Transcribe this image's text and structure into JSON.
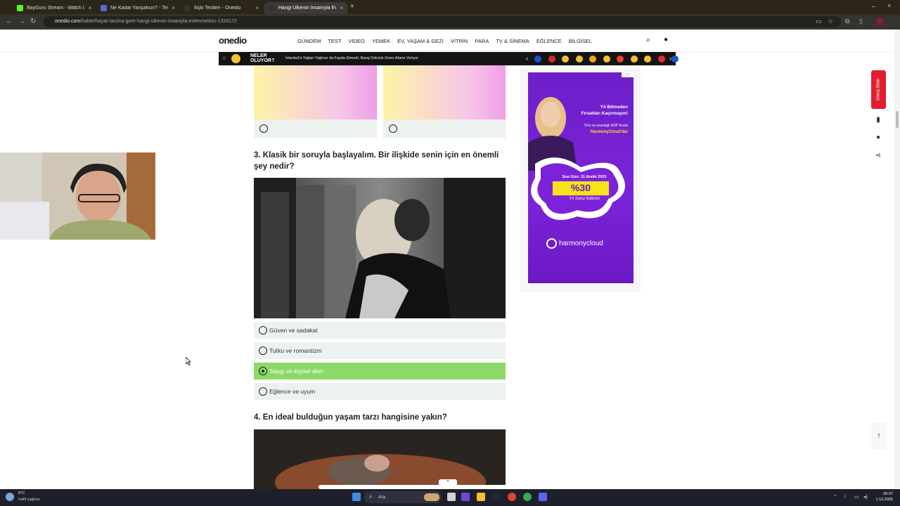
{
  "browser": {
    "tabs": [
      {
        "title": "BayGuru Stream - Watch Live o",
        "color": "#53fc18",
        "active": false
      },
      {
        "title": "Ne Kadar Yavşaksın? - Test",
        "color": "#5b67d9",
        "active": false
      },
      {
        "title": "İlişki Testleri - Onedio",
        "color": "#333333",
        "active": false
      },
      {
        "title": "Hangi Ülkenin İnsanıyla Evlenm",
        "color": "#333333",
        "active": true
      }
    ],
    "url_host": "onedio.com",
    "url_path": "/haber/hayat-tarzina-gore-hangi-ulkenin-insaniyla-evlenmelisin-1326172"
  },
  "site": {
    "logo": "onedio",
    "menu": [
      "GÜNDEM",
      "TEST",
      "VİDEO",
      "YEMEK",
      "EV, YAŞAM & GEZİ",
      "VİTRİN",
      "PARA",
      "TV & SİNEMA",
      "EĞLENCE",
      "BİLGİSEL"
    ],
    "news_label_line1": "NELER",
    "news_label_line2": "OLUYOR?",
    "news_text": "İstanbul'a Yağan Yağmur da Fayda Etmedi, Baraj Doluluk Oranı Alarm Veriyor",
    "emoji_colors": [
      "#1d4fd8",
      "#d12c2c",
      "#f2c230",
      "#f2c230",
      "#f2a020",
      "#f2c230",
      "#e0442f",
      "#f2c230",
      "#f2c230",
      "#e32c2c",
      "#1a56c7"
    ]
  },
  "quiz": {
    "q3": "3. Klasik bir soruyla başlayalım. Bir ilişkide senin için en önemli şey nedir?",
    "q3_answers": [
      {
        "label": "Güven ve sadakat",
        "selected": false
      },
      {
        "label": "Tutku ve romantizm",
        "selected": false
      },
      {
        "label": "Saygı ve kişisel alan",
        "selected": true
      },
      {
        "label": "Eğlence ve uyum",
        "selected": false
      }
    ],
    "q4": "4. En ideal bulduğun yaşam tarzı hangisine yakın?"
  },
  "ad": {
    "headline1": "Yıl Bitmeden",
    "headline2": "Fırsatları Kaçırmayın!",
    "sub1": "Yılın en avantajlı ERP fırsatı",
    "sub2": "HarmonyCloud'da!",
    "date_text": "Son Gün: 31 Aralık 2025",
    "discount": "%30",
    "discount_sub": "Yıl Sonu İndirimi",
    "brand": "harmonycloud"
  },
  "side": {
    "feedback": "Görüş Bildir"
  },
  "taskbar": {
    "temp": "6°C",
    "weather": "Hafif yağmur",
    "search": "Ara",
    "time": "00:27",
    "date": "1.12.2025"
  }
}
